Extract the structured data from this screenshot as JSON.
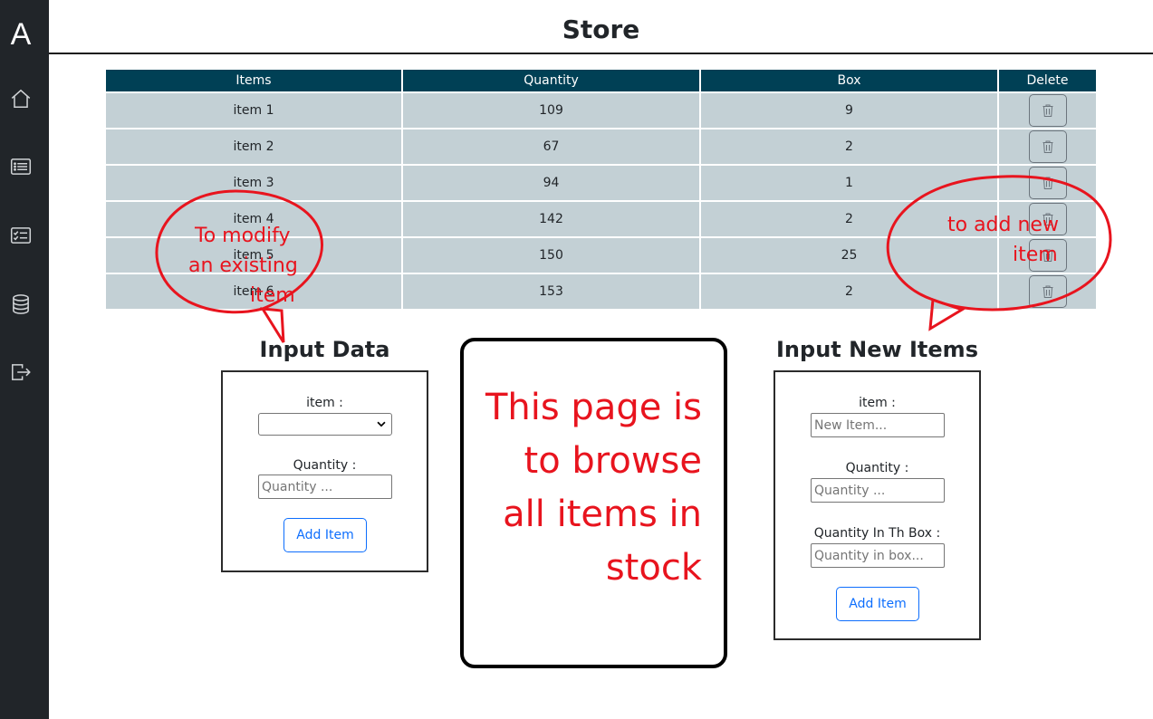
{
  "sidebar": {
    "brand": "A",
    "items": [
      {
        "icon": "home-icon"
      },
      {
        "icon": "list-icon"
      },
      {
        "icon": "checklist-icon"
      },
      {
        "icon": "database-icon"
      },
      {
        "icon": "logout-icon"
      }
    ]
  },
  "header": {
    "title": "Store"
  },
  "table": {
    "columns": [
      "Items",
      "Quantity",
      "Box",
      "Delete"
    ],
    "rows": [
      {
        "item": "item 1",
        "quantity": "109",
        "box": "9"
      },
      {
        "item": "item 2",
        "quantity": "67",
        "box": "2"
      },
      {
        "item": "item 3",
        "quantity": "94",
        "box": "1"
      },
      {
        "item": "item 4",
        "quantity": "142",
        "box": "2"
      },
      {
        "item": "item 5",
        "quantity": "150",
        "box": "25"
      },
      {
        "item": "item 6",
        "quantity": "153",
        "box": "2"
      }
    ]
  },
  "input_data": {
    "title": "Input Data",
    "item_label": "item :",
    "item_value": "",
    "quantity_label": "Quantity :",
    "quantity_placeholder": "Quantity ...",
    "button": "Add Item"
  },
  "input_new": {
    "title": "Input New Items",
    "item_label": "item :",
    "item_placeholder": "New Item...",
    "quantity_label": "Quantity :",
    "quantity_placeholder": "Quantity ...",
    "box_label": "Quantity In Th Box :",
    "box_placeholder": "Quantity in box...",
    "button": "Add Item"
  },
  "annotations": {
    "center_note": "This page is to browse all items in stock",
    "modify_note": [
      "To modify",
      "an existing",
      "item"
    ],
    "add_note": [
      "to add new",
      "item"
    ],
    "color": "#e8141e"
  },
  "colors": {
    "sidebar": "#212529",
    "table_header": "#004055",
    "table_row": "#c3d0d5",
    "button_accent": "#0d6efd"
  }
}
